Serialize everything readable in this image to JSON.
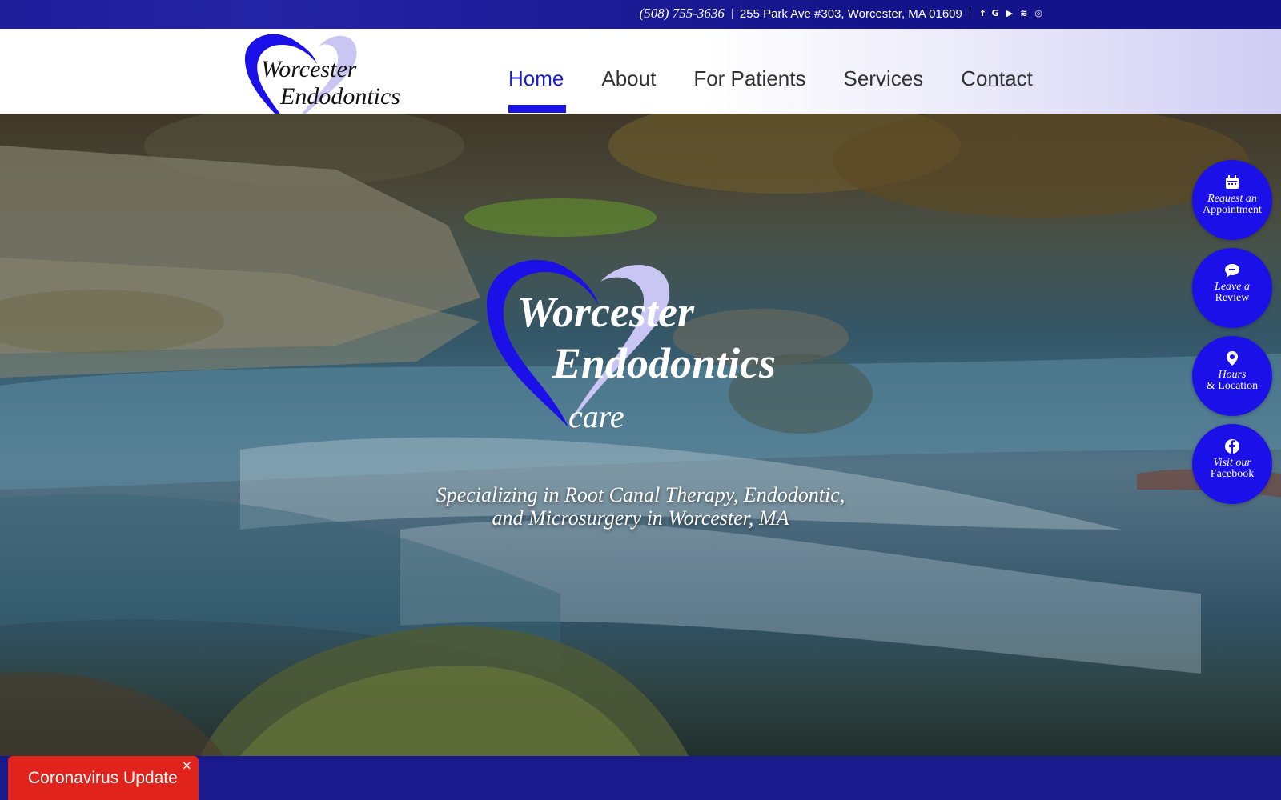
{
  "topbar": {
    "phone": "(508) 755-3636",
    "separator": "|",
    "address": "255 Park Ave #303, Worcester, MA 01609",
    "social": [
      {
        "icon": "facebook-icon",
        "glyph": "f"
      },
      {
        "icon": "google-icon",
        "glyph": "G"
      },
      {
        "icon": "youtube-icon",
        "glyph": "▶"
      },
      {
        "icon": "rss-icon",
        "glyph": "≋"
      },
      {
        "icon": "instagram-icon",
        "glyph": "◎"
      }
    ]
  },
  "logo": {
    "line1": "Worcester",
    "line2": "Endodontics",
    "line3": "care"
  },
  "nav": {
    "items": [
      "Home",
      "About",
      "For Patients",
      "Services",
      "Contact"
    ],
    "active": "Home"
  },
  "hero": {
    "tagline_line1": "Specializing in Root Canal Therapy, Endodontic,",
    "tagline_line2": "and Microsurgery in Worcester, MA"
  },
  "side_buttons": [
    {
      "icon": "calendar-icon",
      "line1": "Request an",
      "line2": "Appointment"
    },
    {
      "icon": "chat-icon",
      "line1": "Leave a",
      "line2": "Review"
    },
    {
      "icon": "location-pin-icon",
      "line1": "Hours",
      "line2": "& Location"
    },
    {
      "icon": "facebook-icon",
      "line1": "Visit our",
      "line2": "Facebook"
    }
  ],
  "covid": {
    "label": "Coronavirus Update",
    "close": "×"
  },
  "colors": {
    "brand_blue": "#1c10e8",
    "navy": "#16168c",
    "alert_red": "#e0241c"
  }
}
